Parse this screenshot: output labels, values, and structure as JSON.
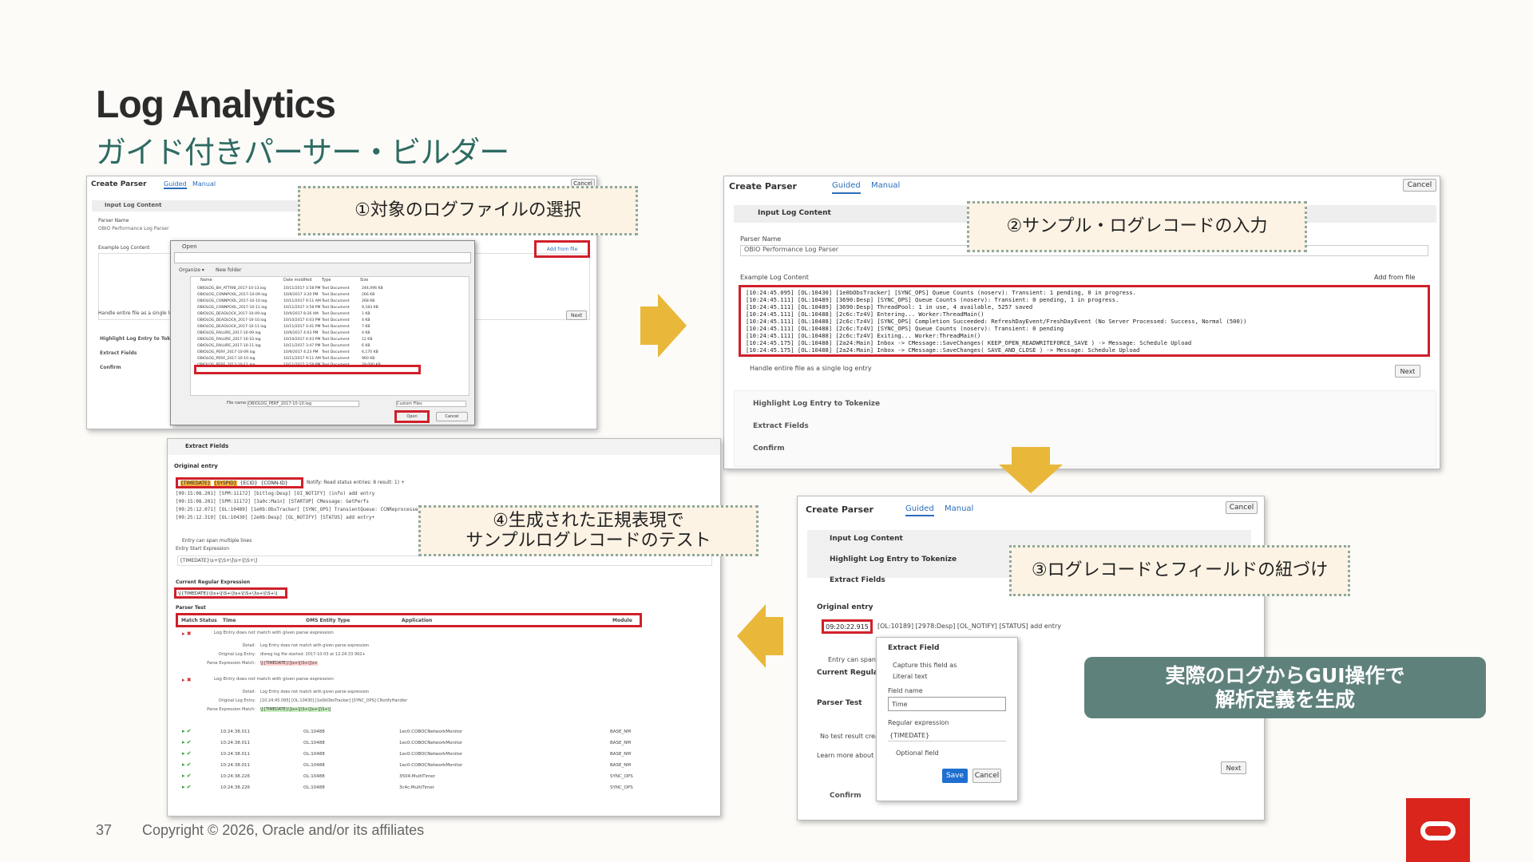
{
  "slide": {
    "title": "Log Analytics",
    "subtitle": "ガイド付きパーサー・ビルダー",
    "page_number": "37",
    "copyright": "Copyright © 2026, Oracle and/or its affiliates",
    "slogan_line1": "実際のログからGUI操作で",
    "slogan_line2": "解析定義を生成"
  },
  "callouts": {
    "step1": "①対象のログファイルの選択",
    "step2": "②サンプル・ログレコードの入力",
    "step3": "③ログレコードとフィールドの紐づけ",
    "step4_line1": "④生成された正規表現で",
    "step4_line2": "サンプルログレコードのテスト"
  },
  "panel1": {
    "title": "Create Parser",
    "tab_guided": "Guided",
    "tab_manual": "Manual",
    "cancel": "Cancel",
    "section_input": "Input Log Content",
    "parser_name_label": "Parser Name",
    "parser_name_value": "OBIO Performance Log Parser",
    "example_label": "Example Log Content",
    "add_from_file": "Add from file",
    "handle_entire": "Handle entire file as a single log entry",
    "next": "Next",
    "sec_highlight": "Highlight Log Entry to Tokenize",
    "sec_extract": "Extract Fields",
    "sec_confirm": "Confirm",
    "dialog_title": "Open",
    "organize": "Organize ▾",
    "new_folder": "New folder",
    "col_name": "Name",
    "col_date": "Date modified",
    "col_type": "Type",
    "col_size": "Size",
    "files": [
      {
        "name": "OBIOLOG_BH_ATTRIB_2017-10-13.log",
        "date": "10/11/2017 3:58 PM",
        "type": "Text Document",
        "size": "244,096 KB"
      },
      {
        "name": "OBIOLOG_CONNPOOL_2017-10-09.log",
        "date": "10/9/2017 3:20 PM",
        "type": "Text Document",
        "size": "266 KB"
      },
      {
        "name": "OBIOLOG_CONNPOOL_2017-10-10.log",
        "date": "10/11/2017 9:11 AM",
        "type": "Text Document",
        "size": "268 KB"
      },
      {
        "name": "OBIOLOG_CONNPOOL_2017-10-11.log",
        "date": "10/11/2017 3:58 PM",
        "type": "Text Document",
        "size": "9,183 KB"
      },
      {
        "name": "OBIOLOG_DEADLOCK_2017-10-09.log",
        "date": "10/9/2017 8:26 AM",
        "type": "Text Document",
        "size": "1 KB"
      },
      {
        "name": "OBIOLOG_DEADLOCK_2017-10-10.log",
        "date": "10/10/2017 4:03 PM",
        "type": "Text Document",
        "size": "4 KB"
      },
      {
        "name": "OBIOLOG_DEADLOCK_2017-10-11.log",
        "date": "10/11/2017 3:41 PM",
        "type": "Text Document",
        "size": "7 KB"
      },
      {
        "name": "OBIOLOG_FAILURE_2017-10-09.log",
        "date": "10/9/2017 4:03 PM",
        "type": "Text Document",
        "size": "4 KB"
      },
      {
        "name": "OBIOLOG_FAILURE_2017-10-10.log",
        "date": "10/10/2017 4:03 PM",
        "type": "Text Document",
        "size": "12 KB"
      },
      {
        "name": "OBIOLOG_FAILURE_2017-10-11.log",
        "date": "10/11/2017 3:47 PM",
        "type": "Text Document",
        "size": "6 KB"
      },
      {
        "name": "OBIOLOG_PERF_2017-10-09.log",
        "date": "10/9/2017 4:23 PM",
        "type": "Text Document",
        "size": "6,170 KB"
      },
      {
        "name": "OBIOLOG_PERF_2017-10-10.log",
        "date": "10/11/2017 9:11 AM",
        "type": "Text Document",
        "size": "960 KB"
      },
      {
        "name": "OBIOLOG_PERF_2017-10-11.log",
        "date": "10/11/2017 3:58 PM",
        "type": "Text Document",
        "size": "29,000 KB"
      }
    ],
    "file_name_label": "File name:",
    "file_name_value": "OBIOLOG_PERF_2017-10-10.log",
    "filter_value": "Custom Files",
    "open_btn": "Open",
    "dialog_cancel": "Cancel"
  },
  "panel2": {
    "title": "Create Parser",
    "tab_guided": "Guided",
    "tab_manual": "Manual",
    "cancel": "Cancel",
    "section_input": "Input Log Content",
    "parser_name_label": "Parser Name",
    "parser_name_value": "OBIO Performance Log Parser",
    "example_label": "Example Log Content",
    "add_from_file": "Add from file",
    "log_lines": [
      "[10:24:45.095] [OL:10430] [1e0bObsTracker] [SYNC_OPS] Queue Counts (noserv): Transient: 1 pending, 0 in progress.",
      "[10:24:45.111] [OL:10489] [3690:Desp] [SYNC_OPS] Queue Counts (noserv): Transient: 0 pending, 1 in progress.",
      "[10:24:45.111] [OL:10489] [3690:Desp] ThreadPool: 1 in use, 4 available, 5257 saved",
      "[10:24:45.111] [OL:10488] [2c6c:Tz4V] Entering... Worker:ThreadMain()",
      "[10:24:45.111] [OL:10488] [2c6c:Tz4V] [SYNC_OPS] Completion Succeeded: RefreshDayEvent/FreshDayEvent (No Server Processed: Success, Normal (500))",
      "[10:24:45.111] [OL:10488] [2c6c:Tz4V] [SYNC_OPS] Queue Counts (noserv): Transient: 0 pending",
      "[10:24:45.111] [OL:10488] [2c6c:Tz4V] Exiting... Worker:ThreadMain()",
      "[10:24:45.175] [OL:10488] [2a24:Main] Inbox -> CMessage::SaveChanges( KEEP_OPEN_READWRITEFORCE_SAVE ) -> Message: Schedule Upload",
      "[10:24:45.175] [OL:10488] [2a24:Main] Inbox -> CMessage::SaveChanges( SAVE_AND_CLOSE ) -> Message: Schedule Upload"
    ],
    "handle_entire": "Handle entire file as a single log entry",
    "next": "Next",
    "sec_highlight": "Highlight Log Entry to Tokenize",
    "sec_extract": "Extract Fields",
    "sec_confirm": "Confirm"
  },
  "panel3": {
    "title": "Create Parser",
    "tab_guided": "Guided",
    "tab_manual": "Manual",
    "cancel": "Cancel",
    "sec_input": "Input Log Content",
    "sec_highlight": "Highlight Log Entry to Tokenize",
    "sec_extract": "Extract Fields",
    "original_entry": "Original entry",
    "token_time": "09:20:22.915",
    "entry_rest": "[OL:10189] [2978:Desp] [OL_NOTIFY] [STATUS] add entry",
    "entry_can_span": "Entry can span multiple lines",
    "current_regex": "Current Regular E",
    "parser_test": "Parser Test",
    "no_test_result": "No test result crea",
    "learn_more": "Learn more about W",
    "next": "Next",
    "sec_confirm": "Confirm",
    "popup_title": "Extract Field",
    "opt_capture": "Capture this field as",
    "opt_literal": "Literal text",
    "field_name_label": "Field name",
    "field_name_value": "Time",
    "regex_label": "Regular expression",
    "regex_value": "{TIMEDATE}",
    "optional_field": "Optional field",
    "save": "Save",
    "popup_cancel": "Cancel"
  },
  "panel4": {
    "section": "Extract Fields",
    "original_entry": "Original entry",
    "tok_time": "{TIMEDATE}",
    "tok_sys": "{SYSPID}",
    "tok_ecid": "{ECID}",
    "tok_conn": "{CONN-ID}",
    "entry_tail": "Notify: Read status entries: 8 result: 1) +",
    "entry_lines": [
      "[09:15:08.201] [SPM:11172] [bitlog:Desp] [OI_NOTIFY] (info) add entry",
      "[09:15:08.201] [SPM:11172] [3a0c:Main] [STARTUP] CMessage: GetPerfs",
      "[09:25:12.071] [OL:10489] [1e0b:ObsTracker] [SYNC_OPS] TransientQueue: CCNReprocessed",
      "[09:25:12.319] [OL:10430] [2e0b:Desp] [OL_NOTIFY] [STATUS] add entry+"
    ],
    "entry_can_span": "Entry can span multiple lines",
    "entry_start_expr": "Entry Start Expression",
    "entry_start_value": "{TIMEDATE}\\s+\\[\\S+\\]\\s+\\[\\S+\\]",
    "current_regex_label": "Current Regular Expression",
    "current_regex_value": "\\[{TIMEDATE}\\]\\s+\\[\\S+\\]\\s+\\[\\S+\\]\\s+\\[\\S+\\]",
    "parser_test": "Parser Test",
    "columns": [
      "Match Status",
      "Time",
      "OMS Entity Type",
      "Application",
      "Module"
    ],
    "fail_msg": "Log Entry does not match with given parse expression",
    "fail_details": [
      {
        "label": "Detail:",
        "value": "Log Entry does not match with given parse expression"
      },
      {
        "label": "Original Log Entry:",
        "value": "dlsreg log file started: 2017-10-03 at 12:24:33 992+"
      },
      {
        "label": "Parse Expression Match:",
        "value": "\\[{TIMEDATE}\\]\\s+\\[\\S+\\]\\s+"
      }
    ],
    "fail_details2": [
      {
        "label": "Detail:",
        "value": "Log Entry does not match with given parse expression"
      },
      {
        "label": "Original Log Entry:",
        "value": "[10:24:45.095] [OL:10430] [1e0bObsTracker] [SYNC_OPS] CNotifyHandler"
      },
      {
        "label": "Parse Expression Match:",
        "value": "\\[{TIMEDATE}\\]\\s+\\[\\S+\\]\\s+\\[\\S+\\]"
      }
    ],
    "rows": [
      {
        "time": "10:24:38.011",
        "entity": "OL:10488",
        "app": "1ec0:COBOCNetworkMonitor",
        "module": "BASE_NM"
      },
      {
        "time": "10:24:38.011",
        "entity": "OL:10488",
        "app": "1ec0:COBOCNetworkMonitor",
        "module": "BASE_NM"
      },
      {
        "time": "10:24:38.011",
        "entity": "OL:10488",
        "app": "1ec0:COBOCNetworkMonitor",
        "module": "BASE_NM"
      },
      {
        "time": "10:24:38.011",
        "entity": "OL:10488",
        "app": "1ec0:COBOCNetworkMonitor",
        "module": "BASE_NM"
      },
      {
        "time": "10:24:38.226",
        "entity": "OL:10488",
        "app": "3504:MultiTimer",
        "module": "SYNC_OPS"
      },
      {
        "time": "10:24:38.226",
        "entity": "OL:10488",
        "app": "3c4c:MultiTimer",
        "module": "SYNC_OPS"
      }
    ]
  },
  "colors": {
    "accent_red": "#d0202a",
    "arrow": "#e9b83b",
    "slogan_bg": "#5f817c",
    "subtitle": "#2e6b62",
    "oracle_red": "#d9251c"
  }
}
